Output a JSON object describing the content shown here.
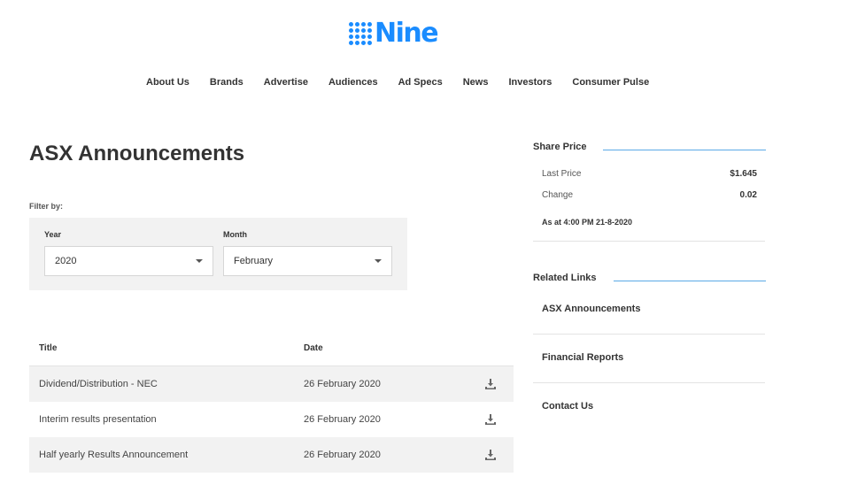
{
  "brand": {
    "logo_text": "Nine",
    "brand_color": "#1a8cff"
  },
  "nav": {
    "items": [
      {
        "label": "About Us"
      },
      {
        "label": "Brands"
      },
      {
        "label": "Advertise"
      },
      {
        "label": "Audiences"
      },
      {
        "label": "Ad Specs"
      },
      {
        "label": "News"
      },
      {
        "label": "Investors"
      },
      {
        "label": "Consumer Pulse"
      }
    ]
  },
  "main": {
    "title": "ASX Announcements",
    "filter": {
      "label": "Filter by:",
      "year_label": "Year",
      "year_value": "2020",
      "month_label": "Month",
      "month_value": "February"
    },
    "table": {
      "headers": {
        "title": "Title",
        "date": "Date"
      },
      "rows": [
        {
          "title": "Dividend/Distribution - NEC",
          "date": "26 February 2020",
          "icon": "download-icon"
        },
        {
          "title": "Interim results presentation",
          "date": "26 February 2020",
          "icon": "download-icon"
        },
        {
          "title": "Half yearly Results Announcement",
          "date": "26 February 2020",
          "icon": "download-icon"
        }
      ]
    }
  },
  "sidebar": {
    "share_price": {
      "title": "Share Price",
      "last_price_label": "Last Price",
      "last_price_value": "$1.645",
      "change_label": "Change",
      "change_value": "0.02",
      "as_at": "As at 4:00 PM 21-8-2020"
    },
    "related_links": {
      "title": "Related Links",
      "items": [
        {
          "label": "ASX Announcements"
        },
        {
          "label": "Financial Reports"
        },
        {
          "label": "Contact Us"
        }
      ]
    },
    "accent_color": "#5aa9e6"
  }
}
